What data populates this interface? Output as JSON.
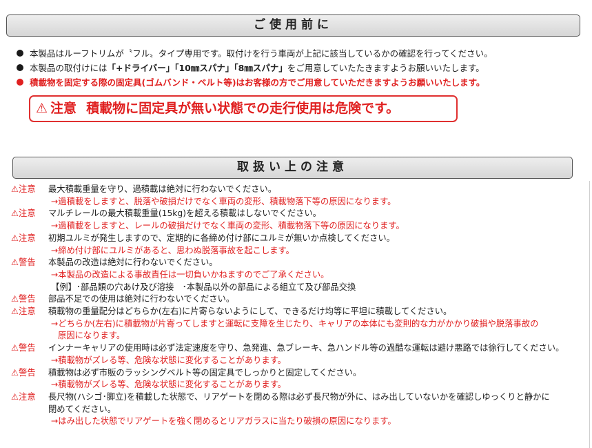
{
  "section1": {
    "title": "ご使用前に",
    "bullets": [
      "本製品はルーフトリムが〝フル〟タイプ専用です。取付けを行う車両が上記に該当しているかの確認を行ってください。",
      {
        "pre": "本製品の取付けには",
        "bold": "「+ドライバー」「10㎜スパナ」「8㎜スパナ」",
        "post": "をご用意していたたきますようお願いいたします。"
      },
      "積載物を固定する際の固定具(ゴムバンド・ベルト等)はお客様の方でご用意していただきますようお願いいたします。"
    ],
    "warning": {
      "icon": "⚠",
      "label": "注意",
      "text": "積載物に固定具が無い状態での走行使用は危険です。"
    }
  },
  "section2": {
    "title": "取扱い上の注意",
    "items": [
      {
        "tag": "⚠注意",
        "text": "最大積載重量を守り、過積載は絶対に行わないでください。",
        "subs": [
          "→過積載をしますと、脱落や破損だけでなく車両の変形、積載物落下等の原因になります。"
        ]
      },
      {
        "tag": "⚠注意",
        "text": "マルチレールの最大積載重量(15kg)を超える積載はしないでください。",
        "subs": [
          "→過積載をしますと、レールの破損だけでなく車両の変形、積載物落下等の原因になります。"
        ]
      },
      {
        "tag": "⚠注意",
        "text": "初期ユルミが発生しますので、定期的に各締め付け部にユルミが無いか点検してください。",
        "subs": [
          "→締め付け部にユルミがあると、思わぬ脱落事故を起こします。"
        ]
      },
      {
        "tag": "⚠警告",
        "text": "本製品の改造は絶対に行わないでください。",
        "subs": [
          "→本製品の改造による事故責任は一切負いかねますのでご了承ください。"
        ],
        "plain": "【例】･部品類の穴あけ及び溶接　･本製品以外の部品による組立て及び部品交換"
      },
      {
        "tag": "⚠警告",
        "text": "部品不足での使用は絶対に行わないでください。",
        "subs": []
      },
      {
        "tag": "⚠注意",
        "text": "積載物の重量配分はどちらか(左右)に片寄らないようにして、できるだけ均等に平坦に積載してください。",
        "subs": [
          "→どちらか(左右)に積載物が片寄ってしますと運転に支障を生じたり、キャリアの本体にも変則的な力がかかり破損や脱落事故の",
          "原因になります。"
        ]
      },
      {
        "tag": "⚠警告",
        "text": "インナーキャリアの使用時は必ず法定速度を守り、急発進、急ブレーキ、急ハンドル等の過酷な運転は避け悪路では徐行してください。",
        "subs": [
          "→積載物がズレる等、危険な状態に変化することがあります。"
        ]
      },
      {
        "tag": "⚠警告",
        "text": "積載物は必ず市販のラッシングベルト等の固定具でしっかりと固定してください。",
        "subs": [
          "→積載物がズレる等、危険な状態に変化することがあります。"
        ]
      },
      {
        "tag": "⚠注意",
        "text": "長尺物(ハシゴ･脚立)を積載した状態で、リアゲートを閉める際は必ず長尺物が外に、はみ出していないかを確認しゆっくりと静かに",
        "text2": "閉めてください。",
        "subs": [
          "→はみ出した状態でリアゲートを強く閉めるとリアガラスに当たり破損の原因になります。"
        ]
      }
    ]
  }
}
